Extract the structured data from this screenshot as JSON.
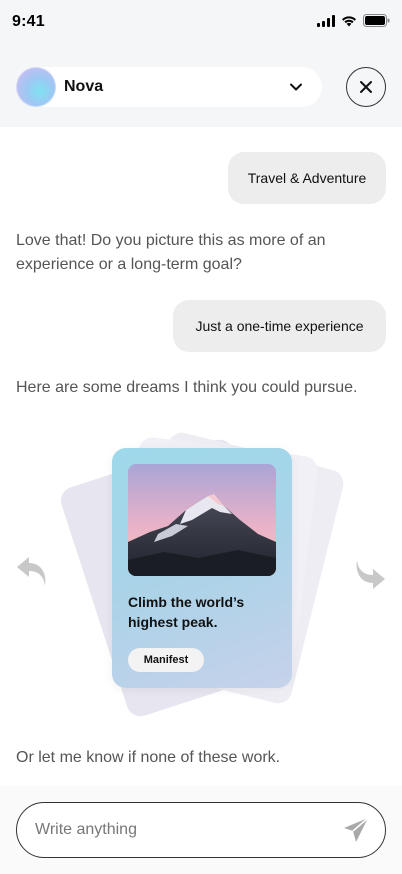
{
  "status_bar": {
    "time": "9:41",
    "icons": [
      "signal-icon",
      "wifi-icon",
      "battery-icon"
    ]
  },
  "header": {
    "assistant_name": "Nova",
    "dropdown_icon": "chevron-down-icon",
    "close_icon": "close-icon"
  },
  "chat": {
    "messages": [
      {
        "role": "user",
        "text": "Travel & Adventure"
      },
      {
        "role": "assistant",
        "text": "Love that! Do you picture this as more of an experience or a long-term goal?"
      },
      {
        "role": "user",
        "text": "Just a one-time experience"
      },
      {
        "role": "assistant",
        "text": "Here are some dreams I think you could pursue."
      },
      {
        "role": "assistant",
        "text": "Or let me know if none of these work."
      }
    ]
  },
  "dream_card": {
    "title": "Climb the world’s highest peak.",
    "button_label": "Manifest",
    "image": "mountain-peak-photo",
    "prev_icon": "undo-arrow-icon",
    "next_icon": "redo-arrow-icon"
  },
  "composer": {
    "placeholder": "Write anything",
    "value": "",
    "send_icon": "send-icon"
  },
  "colors": {
    "background": "#ffffff",
    "header_bg": "#f5f6f8",
    "user_bubble": "#ededed",
    "assistant_text": "#555555",
    "card_gradient_start": "#9ed9ea",
    "card_gradient_end": "#c6d2ea"
  }
}
